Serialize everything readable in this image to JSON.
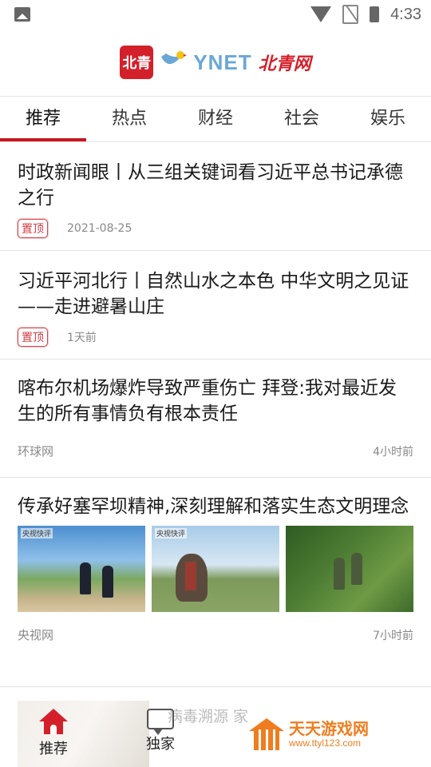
{
  "status": {
    "time": "4:33"
  },
  "header": {
    "logo_box": "北青",
    "logo_text": "YNET",
    "logo_cn": "北青网"
  },
  "tabs": [
    {
      "label": "推荐",
      "active": true
    },
    {
      "label": "热点"
    },
    {
      "label": "财经"
    },
    {
      "label": "社会"
    },
    {
      "label": "娱乐"
    }
  ],
  "articles": [
    {
      "title": "时政新闻眼丨从三组关键词看习近平总书记承德之行",
      "tag": "置顶",
      "time": "2021-08-25"
    },
    {
      "title": "习近平河北行丨自然山水之本色 中华文明之见证——走进避暑山庄",
      "tag": "置顶",
      "time": "1天前"
    },
    {
      "title": "喀布尔机场爆炸导致严重伤亡 拜登:我对最近发生的所有事情负有根本责任",
      "source": "环球网",
      "time": "4小时前"
    },
    {
      "title": "传承好塞罕坝精神,深刻理解和落实生态文明理念",
      "source": "央视网",
      "time": "7小时前",
      "image_labels": [
        "央视快评",
        "央视快评",
        ""
      ]
    }
  ],
  "bottom_nav": {
    "items": [
      {
        "label": "推荐",
        "active": true
      },
      {
        "label": "独家"
      }
    ],
    "ghost_text": "病毒溯源 家"
  },
  "watermark": {
    "title": "天天游戏网",
    "url": "www.ttyl123.com"
  }
}
